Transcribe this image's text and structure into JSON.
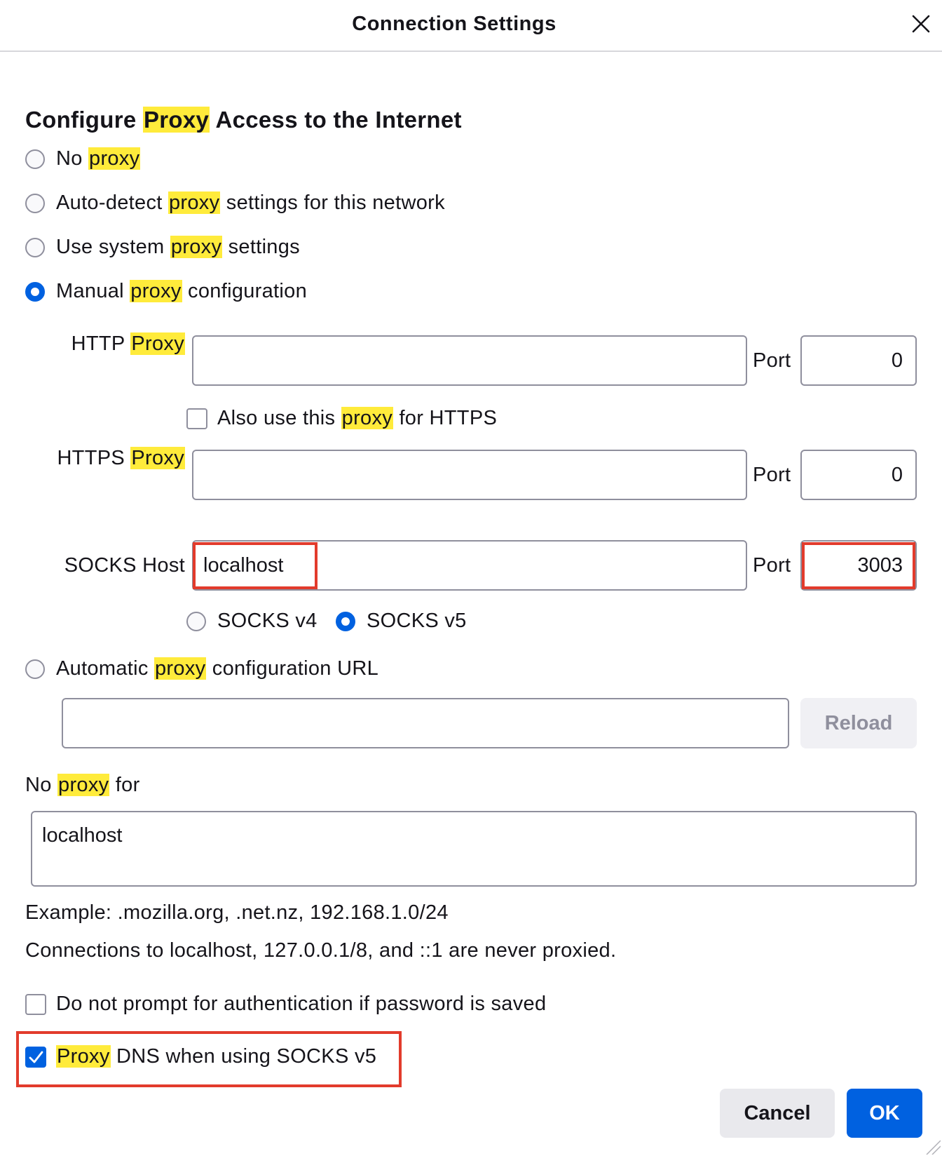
{
  "window": {
    "title": "Connection Settings"
  },
  "heading": {
    "pre": "Configure ",
    "hl": "Proxy",
    "post": " Access to the Internet"
  },
  "options": {
    "no_proxy": {
      "pre": "No ",
      "hl": "proxy",
      "post": ""
    },
    "auto_detect": {
      "pre": "Auto-detect ",
      "hl": "proxy",
      "post": " settings for this network"
    },
    "system": {
      "pre": "Use system ",
      "hl": "proxy",
      "post": " settings"
    },
    "manual": {
      "pre": "Manual ",
      "hl": "proxy",
      "post": " configuration"
    },
    "auto_url": {
      "pre": "Automatic ",
      "hl": "proxy",
      "post": " configuration URL"
    }
  },
  "selected_option": "manual",
  "http": {
    "label_pre": "HTTP ",
    "label_hl": "Proxy",
    "host": "",
    "port_label": "Port",
    "port": "0"
  },
  "also_https": {
    "pre": "Also use this ",
    "hl": "proxy",
    "post": " for HTTPS",
    "checked": false
  },
  "https": {
    "label_pre": "HTTPS ",
    "label_hl": "Proxy",
    "host": "",
    "port_label": "Port",
    "port": "0"
  },
  "socks": {
    "label": "SOCKS Host",
    "host": "localhost",
    "port_label": "Port",
    "port": "3003",
    "v4": "SOCKS v4",
    "v5": "SOCKS v5",
    "selected_version": "v5"
  },
  "auto_url": {
    "value": "",
    "reload_label": "Reload"
  },
  "no_proxy_for": {
    "label_pre": "No ",
    "label_hl": "proxy",
    "label_post": " for",
    "value": "localhost"
  },
  "notes": {
    "example": "Example: .mozilla.org, .net.nz, 192.168.1.0/24",
    "localhost": "Connections to localhost, 127.0.0.1/8, and ::1 are never proxied."
  },
  "auth_prompt": {
    "label": "Do not prompt for authentication if password is saved",
    "checked": false
  },
  "proxy_dns": {
    "hl": "Proxy",
    "post": " DNS when using SOCKS v5",
    "checked": true
  },
  "buttons": {
    "cancel": "Cancel",
    "ok": "OK"
  },
  "colors": {
    "accent": "#0061e0",
    "highlight": "#ffeb3b",
    "annotation": "#e23b2c"
  }
}
